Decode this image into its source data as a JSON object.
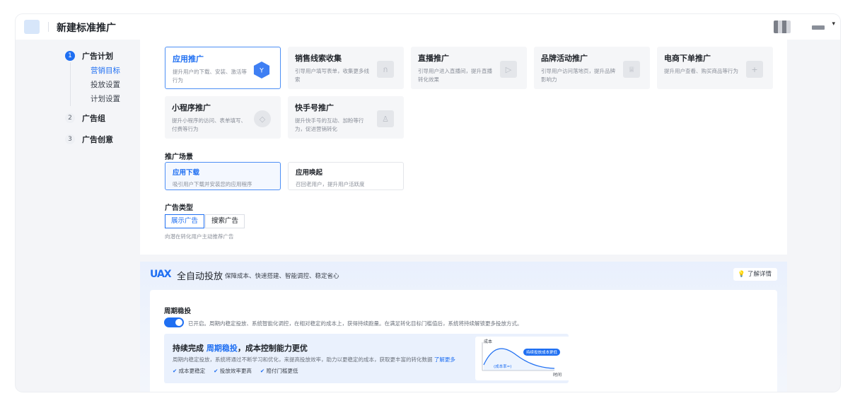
{
  "header": {
    "title": "新建标准推广"
  },
  "sidebar": {
    "steps": [
      {
        "num": "1",
        "label": "广告计划"
      },
      {
        "num": "2",
        "label": "广告组"
      },
      {
        "num": "3",
        "label": "广告创意"
      }
    ],
    "substeps": [
      "营销目标",
      "投放设置",
      "计划设置"
    ]
  },
  "goals": [
    {
      "title": "应用推广",
      "desc": "提升用户的下载、安装、激活等行为",
      "icon": "app-hex-icon",
      "selected": true
    },
    {
      "title": "销售线索收集",
      "desc": "引导用户填写表单，收集更多线索",
      "icon": "form-icon"
    },
    {
      "title": "直播推广",
      "desc": "引导用户进入直播间，提升直播转化效果",
      "icon": "play-icon"
    },
    {
      "title": "品牌活动推广",
      "desc": "引导用户访问落地页，提升品牌影响力",
      "icon": "crown-icon"
    },
    {
      "title": "电商下单推广",
      "desc": "提升用户查看、购买商品等行为",
      "icon": "cart-icon"
    },
    {
      "title": "小程序推广",
      "desc": "提升小程序的访问、表单填写、付费等行为",
      "icon": "miniapp-icon"
    },
    {
      "title": "快手号推广",
      "desc": "提升快手号的互动、加粉等行为，促进营销转化",
      "icon": "user-icon"
    }
  ],
  "scene": {
    "label": "推广场景",
    "options": [
      {
        "title": "应用下载",
        "desc": "吸引用户下载并安装您的应用程序",
        "selected": true
      },
      {
        "title": "应用唤起",
        "desc": "召回老用户，提升用户活跃度"
      }
    ]
  },
  "ad_type": {
    "label": "广告类型",
    "options": [
      "展示广告",
      "搜索广告"
    ],
    "selected": "展示广告",
    "hint": "向潜在转化用户主动推荐广告"
  },
  "uax": {
    "logo": "UAX",
    "title": "全自动投放",
    "subtitle": "保障成本、快速搭建、智能调控、稳定省心",
    "learn": "了解详情",
    "cycle_label": "周期稳投",
    "toggle_on": true,
    "toggle_text": "已开启。周期内稳定投放、系统智能化调控，在相对稳定的成本上，获得持续跑量。在满足转化目标门槛值后，系统将持续解锁更多投放方式。",
    "promo_title_pre": "持续完成",
    "promo_title_hl": "周期稳投",
    "promo_title_post": "，成本控制能力更优",
    "promo_desc": "周期内稳定投放，系统将通过不断学习和优化，来提高投放效率，助力以更稳定的成本，获取更丰富的转化数据",
    "promo_link": "了解更多",
    "checks": [
      "成本更稳定",
      "投放效率更高",
      "赔付门槛更低"
    ],
    "mini_chart": {
      "y_label": "成本",
      "x_label": "时间",
      "pill": "持续投放成本更低",
      "tag": "(成本率=)"
    }
  },
  "colors": {
    "accent": "#1f6ff2",
    "bg": "#f4f5f8"
  }
}
